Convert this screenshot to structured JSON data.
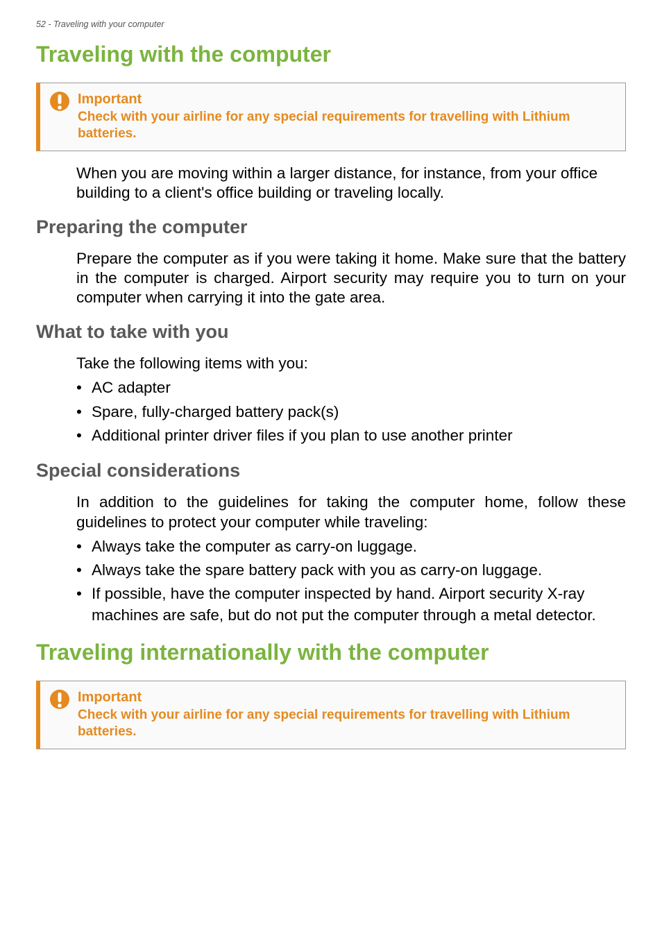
{
  "header": "52 - Traveling with your computer",
  "h1_a": "Traveling with the computer",
  "callout1": {
    "title": "Important",
    "body": "Check with your airline for any special requirements for travelling with Lithium batteries."
  },
  "para_intro": "When you are moving within a larger distance, for instance, from your office building to a client's office building or traveling locally.",
  "h2_prep": "Preparing the computer",
  "para_prep": "Prepare the computer as if you were taking it home. Make sure that the battery in the computer is charged. Airport security may require you to turn on your computer when carrying it into the gate area.",
  "h2_take": "What to take with you",
  "para_take": "Take the following items with you:",
  "bullets_take": [
    "AC adapter",
    "Spare, fully-charged battery pack(s)",
    "Additional printer driver files if you plan to use another printer"
  ],
  "h2_special": "Special considerations",
  "para_special": "In addition to the guidelines for taking the computer home, follow these guidelines to protect your computer while traveling:",
  "bullets_special": [
    "Always take the computer as carry-on luggage.",
    "Always take the spare battery pack with you as carry-on luggage.",
    "If possible, have the computer inspected by hand. Airport security X-ray machines are safe, but do not put the computer through a metal detector."
  ],
  "h1_b": "Traveling internationally with the computer",
  "callout2": {
    "title": "Important",
    "body": "Check with your airline for any special requirements for travelling with Lithium batteries."
  }
}
